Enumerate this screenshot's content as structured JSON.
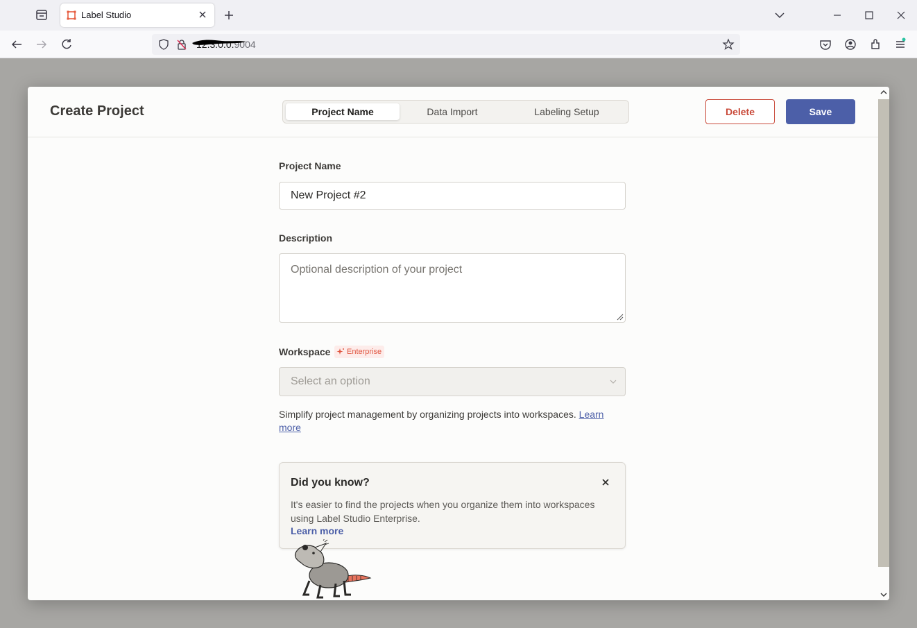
{
  "browser": {
    "tab_title": "Label Studio",
    "url_visible": "9004"
  },
  "modal": {
    "title": "Create Project",
    "steps": [
      {
        "label": "Project Name",
        "active": true
      },
      {
        "label": "Data Import",
        "active": false
      },
      {
        "label": "Labeling Setup",
        "active": false
      }
    ],
    "delete_label": "Delete",
    "save_label": "Save"
  },
  "form": {
    "project_name_label": "Project Name",
    "project_name_value": "New Project #2",
    "description_label": "Description",
    "description_placeholder": "Optional description of your project",
    "workspace_label": "Workspace",
    "enterprise_badge": "Enterprise",
    "workspace_placeholder": "Select an option",
    "helper_text": "Simplify project management by organizing projects into workspaces.",
    "helper_link": "Learn more"
  },
  "tip": {
    "title": "Did you know?",
    "body": "It's easier to find the projects when you organize them into workspaces using Label Studio Enterprise.",
    "link": "Learn more"
  },
  "colors": {
    "accent": "#4c5fa8",
    "danger": "#c94a3a",
    "enterprise": "#e0553f"
  }
}
